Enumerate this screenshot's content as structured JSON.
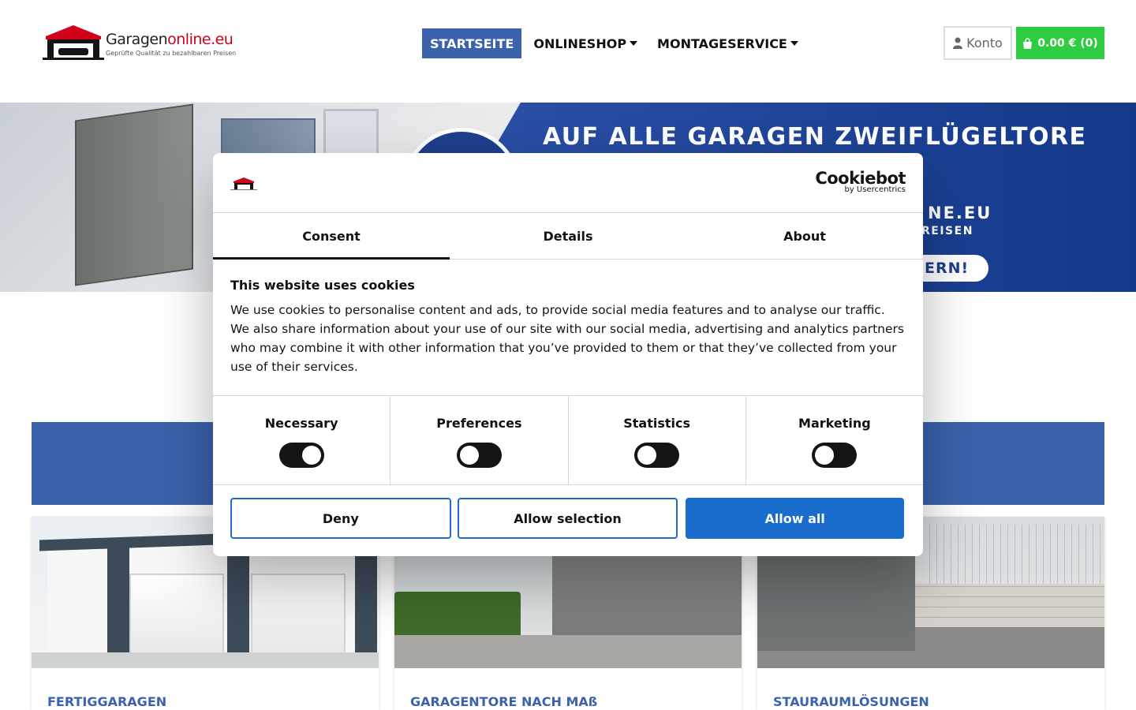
{
  "header": {
    "logo": {
      "name_part1": "Garagen",
      "name_part2": "online.eu",
      "tagline": "Geprüfte Qualität zu bezahlbaren Preisen"
    },
    "nav": [
      {
        "label": "STARTSEITE",
        "active": true
      },
      {
        "label": "ONLINESHOP",
        "dropdown": true
      },
      {
        "label": "MONTAGESERVICE",
        "dropdown": true
      }
    ],
    "konto_label": "Konto",
    "cart_label": "0.00 € (0)",
    "colors": {
      "active_nav": "#3b62ab",
      "cart": "#2ecc40"
    }
  },
  "banner": {
    "title": "AUF ALLE GARAGEN ZWEIFLÜGELTORE",
    "sub1": "NE.EU",
    "sub2": "REISEN",
    "pill": "ERN!"
  },
  "cards": [
    {
      "title": "FERTIGGARAGEN"
    },
    {
      "title": "GARAGENTORE NACH MAß"
    },
    {
      "title": "STAURAUMLÖSUNGEN"
    }
  ],
  "cookie": {
    "brand": "Cookiebot",
    "brand_by": "by Usercentrics",
    "tabs": [
      {
        "label": "Consent",
        "active": true
      },
      {
        "label": "Details"
      },
      {
        "label": "About"
      }
    ],
    "heading": "This website uses cookies",
    "text": "We use cookies to personalise content and ads, to provide social media features and to analyse our traffic. We also share information about your use of our site with our social media, advertising and analytics partners who may combine it with other information that you’ve provided to them or that they’ve collected from your use of their services.",
    "prefs": [
      {
        "label": "Necessary",
        "on": true
      },
      {
        "label": "Preferences",
        "on": false
      },
      {
        "label": "Statistics",
        "on": false
      },
      {
        "label": "Marketing",
        "on": false
      }
    ],
    "buttons": {
      "deny": "Deny",
      "allow_selection": "Allow selection",
      "allow_all": "Allow all"
    },
    "colors": {
      "primary": "#1a6ccd"
    }
  }
}
